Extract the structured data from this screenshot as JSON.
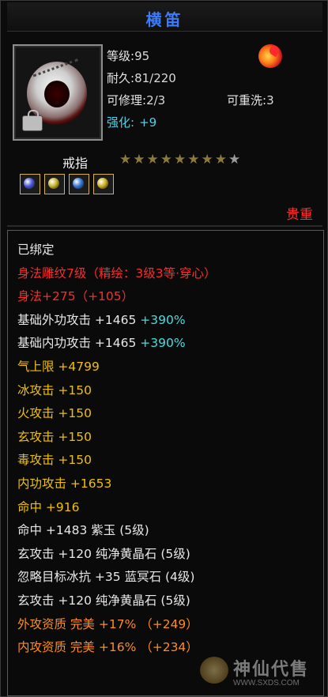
{
  "title": "横笛",
  "item": {
    "icon": "silver-ring-icon",
    "badge_icon": "lock-icon",
    "element_icon": "fire-orb-icon",
    "level_label": "等级:",
    "level_value": "95",
    "durability_label": "耐久:",
    "durability_value": "81/220",
    "repairable_label": "可修理:",
    "repairable_value": "2/3",
    "rewash_label": "可重洗:",
    "rewash_value": "3",
    "enhance_label": "强化:",
    "enhance_value": "+9",
    "type": "戒指",
    "stars_filled": 8,
    "stars_total": 9,
    "rarity": "贵重"
  },
  "gems": [
    {
      "icon": "blue-gem-icon",
      "color": "#4a5ad8"
    },
    {
      "icon": "yellow-gem-icon",
      "color": "#c9b42a"
    },
    {
      "icon": "blue-gem-icon",
      "color": "#3a7ad8"
    },
    {
      "icon": "yellow-gem-icon",
      "color": "#d0b020"
    }
  ],
  "attributes": [
    {
      "parts": [
        {
          "text": "已绑定",
          "color": "white"
        }
      ]
    },
    {
      "parts": [
        {
          "text": "身法雕纹7级（精绘：3级3等·穿心）",
          "color": "red"
        }
      ]
    },
    {
      "parts": [
        {
          "text": "身法+275（+105）",
          "color": "red"
        }
      ]
    },
    {
      "parts": [
        {
          "text": "基础外功攻击 +1465 ",
          "color": "white"
        },
        {
          "text": "+390%",
          "color": "cyan"
        }
      ]
    },
    {
      "parts": [
        {
          "text": "基础内功攻击 +1465 ",
          "color": "white"
        },
        {
          "text": "+390%",
          "color": "cyan"
        }
      ]
    },
    {
      "parts": [
        {
          "text": "气上限 +4799",
          "color": "yellow"
        }
      ]
    },
    {
      "parts": [
        {
          "text": "冰攻击 +150",
          "color": "yellow"
        }
      ]
    },
    {
      "parts": [
        {
          "text": "火攻击 +150",
          "color": "yellow"
        }
      ]
    },
    {
      "parts": [
        {
          "text": "玄攻击 +150",
          "color": "yellow"
        }
      ]
    },
    {
      "parts": [
        {
          "text": "毒攻击 +150",
          "color": "yellow"
        }
      ]
    },
    {
      "parts": [
        {
          "text": "内功攻击 +1653",
          "color": "yellow"
        }
      ]
    },
    {
      "parts": [
        {
          "text": "命中 +916",
          "color": "yellow"
        }
      ]
    },
    {
      "parts": [
        {
          "text": "命中 +1483 紫玉 (5级)",
          "color": "white"
        }
      ]
    },
    {
      "parts": [
        {
          "text": "玄攻击 +120 纯净黄晶石 (5级)",
          "color": "white"
        }
      ]
    },
    {
      "parts": [
        {
          "text": "忽略目标冰抗 +35 蓝冥石 (4级)",
          "color": "white"
        }
      ]
    },
    {
      "parts": [
        {
          "text": "玄攻击 +120 纯净黄晶石 (5级)",
          "color": "white"
        }
      ]
    },
    {
      "parts": [
        {
          "text": "外攻资质  完美 +17% （+249）",
          "color": "orange"
        }
      ]
    },
    {
      "parts": [
        {
          "text": "内攻资质  完美 +16% （+234）",
          "color": "orange"
        }
      ]
    }
  ],
  "watermark": {
    "text": "神仙代售",
    "url": "WWW.SXDS.COM",
    "icon": "watermark-logo-icon"
  }
}
